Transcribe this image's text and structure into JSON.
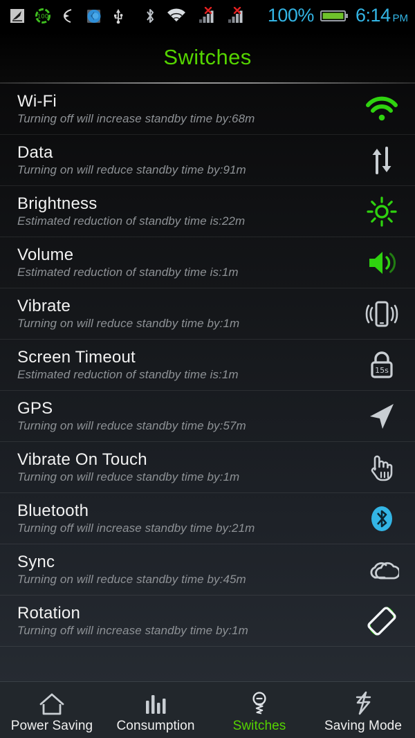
{
  "status_bar": {
    "icons": [
      {
        "name": "signal-boost-icon",
        "label": "signal"
      },
      {
        "name": "battery-100-circle-icon",
        "label": "100"
      },
      {
        "name": "swipe-gesture-icon",
        "label": "gesture"
      },
      {
        "name": "app-update-icon",
        "label": "update"
      },
      {
        "name": "usb-icon",
        "label": "usb"
      },
      {
        "name": "bluetooth-icon",
        "label": "bluetooth"
      },
      {
        "name": "wifi-icon",
        "label": "wifi"
      },
      {
        "name": "sim1-no-service-icon",
        "label": "sim1"
      },
      {
        "name": "sim2-no-service-icon",
        "label": "sim2"
      }
    ],
    "battery_percent": "100%",
    "time": "6:14",
    "meridiem": "PM",
    "accent_color": "#33b5e5"
  },
  "header": {
    "title": "Switches",
    "title_color": "#55d400"
  },
  "list": {
    "rows": [
      {
        "title": "Wi-Fi",
        "subtitle": "Turning off will increase standby time by:68m",
        "icon": "wifi-icon",
        "icon_color": "#2fd30f"
      },
      {
        "title": "Data",
        "subtitle": "Turning on will reduce standby time by:91m",
        "icon": "data-transfer-icon",
        "icon_color": "#c9ced3"
      },
      {
        "title": "Brightness",
        "subtitle": "Estimated reduction of standby time is:22m",
        "icon": "brightness-sun-icon",
        "icon_color": "#2fd30f"
      },
      {
        "title": "Volume",
        "subtitle": "Estimated reduction of standby time is:1m",
        "icon": "volume-speaker-icon",
        "icon_color": "#2fd30f"
      },
      {
        "title": "Vibrate",
        "subtitle": "Turning on will reduce standby time by:1m",
        "icon": "vibrate-phone-icon",
        "icon_color": "#c9ced3"
      },
      {
        "title": "Screen Timeout",
        "subtitle": "Estimated reduction of standby time is:1m",
        "icon": "screen-timeout-lock-icon",
        "icon_color": "#c9ced3",
        "icon_text": "15s"
      },
      {
        "title": "GPS",
        "subtitle": "Turning on will reduce standby time by:57m",
        "icon": "gps-arrow-icon",
        "icon_color": "#c9ced3"
      },
      {
        "title": "Vibrate On Touch",
        "subtitle": "Turning on will reduce standby time by:1m",
        "icon": "touch-hand-icon",
        "icon_color": "#c9ced3"
      },
      {
        "title": "Bluetooth",
        "subtitle": "Turning off will increase standby time by:21m",
        "icon": "bluetooth-icon",
        "icon_color": "#33b5e5"
      },
      {
        "title": "Sync",
        "subtitle": "Turning on will reduce standby time by:45m",
        "icon": "sync-cloud-icon",
        "icon_color": "#c9ced3"
      },
      {
        "title": "Rotation",
        "subtitle": "Turning off will increase standby time by:1m",
        "icon": "rotation-icon",
        "icon_color": "#c9ced3"
      }
    ]
  },
  "tabbar": {
    "tabs": [
      {
        "label": "Power Saving",
        "icon": "home-icon",
        "active": false
      },
      {
        "label": "Consumption",
        "icon": "bar-chart-icon",
        "active": false
      },
      {
        "label": "Switches",
        "icon": "lightbulb-icon",
        "active": true
      },
      {
        "label": "Saving Mode",
        "icon": "lightning-bolt-icon",
        "active": false
      }
    ],
    "active_color": "#55d400"
  }
}
